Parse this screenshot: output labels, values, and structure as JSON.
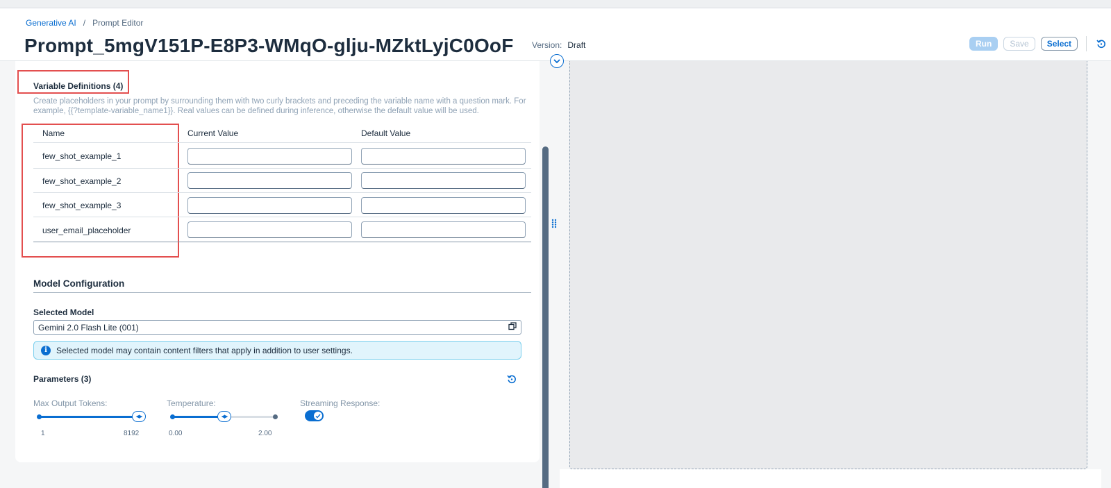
{
  "breadcrumb": {
    "root": "Generative AI",
    "separator": "/",
    "current": "Prompt Editor"
  },
  "header": {
    "title": "Prompt_5mgV151P-E8P3-WMqO-glju-MZktLyjC0OoF",
    "version_label": "Version:",
    "version_value": "Draft",
    "run_label": "Run",
    "save_label": "Save",
    "select_label": "Select",
    "icons": {
      "reset": "reset-icon",
      "collapse": "chevron-down-icon"
    }
  },
  "variables": {
    "title": "Variable Definitions (4)",
    "description": "Create placeholders in your prompt by surrounding them with two curly brackets and preceding the variable name with a question mark. For example, {{?template-variable_name1}}. Real values can be defined during inference, otherwise the default value will be used.",
    "columns": {
      "name": "Name",
      "current": "Current Value",
      "default": "Default Value"
    },
    "rows": [
      {
        "name": "few_shot_example_1",
        "current": "",
        "default": ""
      },
      {
        "name": "few_shot_example_2",
        "current": "",
        "default": ""
      },
      {
        "name": "few_shot_example_3",
        "current": "",
        "default": ""
      },
      {
        "name": "user_email_placeholder",
        "current": "",
        "default": ""
      }
    ]
  },
  "model": {
    "title": "Model Configuration",
    "selected_label": "Selected Model",
    "selected_value": "Gemini 2.0 Flash Lite (001)",
    "info_text": "Selected model may contain content filters that apply in addition to user settings.",
    "parameters_title": "Parameters (3)",
    "max_tokens": {
      "label": "Max Output Tokens:",
      "min": "1",
      "max": "8192",
      "fraction": 1.0
    },
    "temperature": {
      "label": "Temperature:",
      "min": "0.00",
      "max": "2.00",
      "fraction": 0.5
    },
    "streaming": {
      "label": "Streaming Response:",
      "enabled": true
    }
  },
  "colors": {
    "accent": "#0a6ed1",
    "highlight": "#e34f4f",
    "info_bg": "#e1f4fc"
  }
}
